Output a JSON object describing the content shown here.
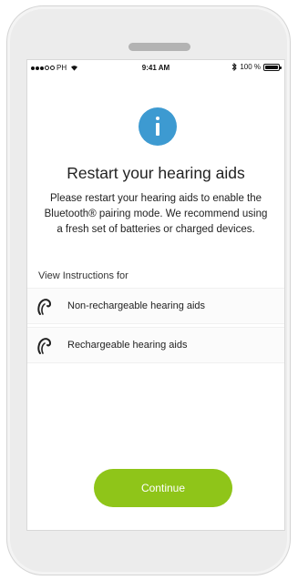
{
  "status_bar": {
    "carrier": "PH",
    "time": "9:41 AM",
    "battery": "100 %",
    "icons": [
      "signal-dots-icon",
      "wifi-icon",
      "bluetooth-icon",
      "battery-icon"
    ]
  },
  "dialog": {
    "icon": "info-icon",
    "title": "Restart your hearing aids",
    "description": "Please restart your hearing aids to enable the Bluetooth® pairing mode. We recommend using a fresh set of batteries or charged devices."
  },
  "instructions": {
    "label": "View Instructions for",
    "items": [
      {
        "label": "Non-rechargeable hearing aids",
        "icon": "hearing-aid-icon"
      },
      {
        "label": "Rechargeable hearing aids",
        "icon": "hearing-aid-icon"
      }
    ]
  },
  "continue_label": "Continue",
  "colors": {
    "accent_green": "#8fc519",
    "info_blue": "#3d9ad1"
  }
}
